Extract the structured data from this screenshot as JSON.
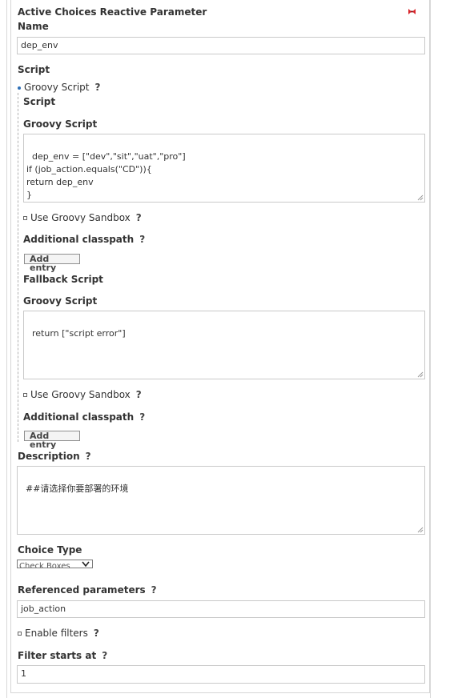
{
  "header": {
    "title": "Active Choices Reactive Parameter"
  },
  "name": {
    "label": "Name",
    "value": "dep_env"
  },
  "script": {
    "label": "Script",
    "option_label": "Groovy Script",
    "help": "?",
    "script_subheading": "Script",
    "groovy_label": "Groovy Script",
    "code": "dep_env = [\"dev\",\"sit\",\"uat\",\"pro\"]\nif (job_action.equals(\"CD\")){\nreturn dep_env\n}",
    "sandbox_label": "Use Groovy Sandbox",
    "classpath_label": "Additional classpath",
    "add_entry": "Add entry",
    "fallback_label": "Fallback Script",
    "fallback_groovy_label": "Groovy Script",
    "fallback_code": "return [\"script error\"]",
    "fallback_sandbox_label": "Use Groovy Sandbox",
    "fallback_classpath_label": "Additional classpath",
    "fallback_add_entry": "Add entry"
  },
  "description": {
    "label": "Description",
    "value": "##请选择你要部署的环境"
  },
  "choice_type": {
    "label": "Choice Type",
    "selected": "Check Boxes"
  },
  "referenced": {
    "label": "Referenced parameters",
    "value": "job_action"
  },
  "filters": {
    "label": "Enable filters"
  },
  "filter_starts": {
    "label": "Filter starts at",
    "value": "1"
  },
  "colors": {
    "delete_icon": "#d9252b",
    "bullet": "#2e6fb7"
  }
}
